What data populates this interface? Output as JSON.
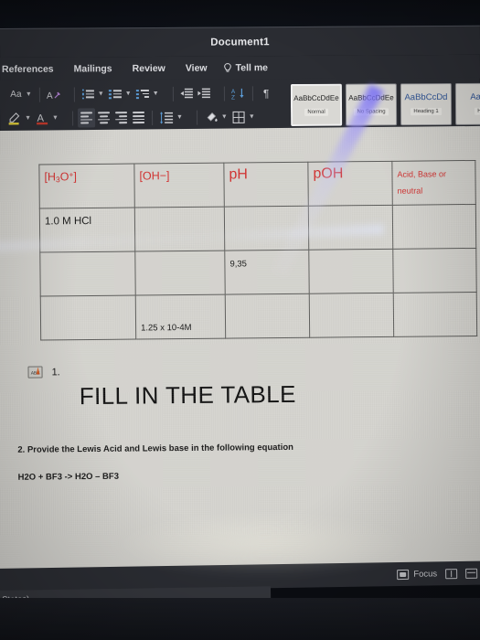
{
  "window": {
    "title": "Document1"
  },
  "ribbon": {
    "tabs": [
      {
        "label": "References"
      },
      {
        "label": "Mailings"
      },
      {
        "label": "Review"
      },
      {
        "label": "View"
      }
    ],
    "tell_me": {
      "label": "Tell me",
      "icon": "lightbulb-icon"
    },
    "row1": {
      "change_case_label": "Aa",
      "clear_formatting_icon": "clear-formatting-icon",
      "bullets_icon": "bullet-list-icon",
      "numbering_icon": "numbered-list-icon",
      "multilevel_icon": "multilevel-list-icon",
      "decrease_indent_icon": "decrease-indent-icon",
      "increase_indent_icon": "increase-indent-icon",
      "sort_icon": "sort-az-icon",
      "show_marks_icon": "paragraph-mark-icon",
      "show_marks_glyph": "¶",
      "sort_glyph": "↓"
    },
    "row2": {
      "highlight_icon": "text-highlight-icon",
      "font_color_icon": "font-color-icon",
      "font_color_glyph": "A",
      "align_left_icon": "align-left-icon",
      "align_center_icon": "align-center-icon",
      "align_right_icon": "align-right-icon",
      "justify_icon": "justify-icon",
      "line_spacing_icon": "line-spacing-icon",
      "shading_icon": "shading-icon",
      "borders_icon": "borders-icon"
    },
    "styles": [
      {
        "sample": "AaBbCcDdEe",
        "name": "Normal",
        "selected": true,
        "heading": false
      },
      {
        "sample": "AaBbCcDdEe",
        "name": "No Spacing",
        "selected": false,
        "heading": false
      },
      {
        "sample": "AaBbCcDd",
        "name": "Heading 1",
        "selected": false,
        "heading": true
      },
      {
        "sample": "AaBb",
        "name": "He",
        "selected": false,
        "heading": true
      }
    ]
  },
  "document": {
    "table": {
      "headers": [
        {
          "text": "[H3O+]",
          "style": "red",
          "html": "[H<sub>3</sub>O<sup>+</sup>]"
        },
        {
          "text": "[OH−]",
          "style": "red",
          "html": "[OH−]"
        },
        {
          "text": "pH",
          "style": "red-big",
          "html": "pH"
        },
        {
          "text": "pOH",
          "style": "red-big",
          "html": "pOH"
        },
        {
          "text": "Acid, Base or neutral",
          "style": "red-small",
          "html": "Acid, Base or neutral"
        }
      ],
      "rows": [
        {
          "cells": [
            "1.0 M HCl",
            "",
            "",
            "",
            ""
          ]
        },
        {
          "cells": [
            "",
            "",
            "9,35",
            "",
            ""
          ]
        },
        {
          "cells": [
            "",
            "1.25 x 10-4M",
            "",
            "",
            ""
          ]
        }
      ]
    },
    "list_number": "1.",
    "proofing_icon": "spellcheck-abc-icon",
    "proofing_label": "ABC",
    "heading": "FILL IN THE TABLE",
    "question2": "2. Provide the Lewis Acid and Lewis base in the following equation",
    "equation": "H2O + BF3 -> H2O – BF3"
  },
  "status_bar": {
    "focus_label": "Focus",
    "focus_icon": "focus-mode-icon",
    "read_mode_icon": "read-mode-icon",
    "web_layout_icon": "web-layout-icon",
    "language_text": "States)"
  },
  "colors": {
    "chrome": "#2b2d33",
    "page": "#d5d4cf",
    "header_red": "#d2302f",
    "heading_blue": "#2f5496",
    "accent_blue": "#5b9bd5",
    "glare_blue": "#786eff"
  }
}
